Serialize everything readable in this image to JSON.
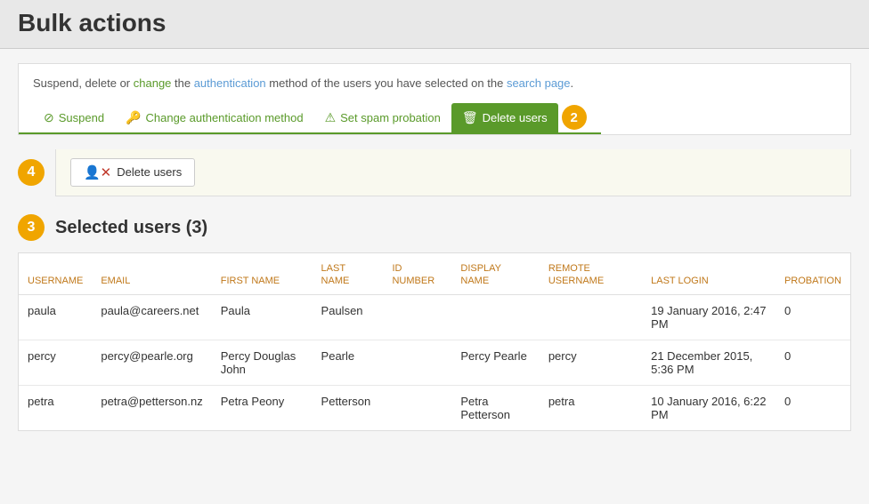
{
  "header": {
    "title": "Bulk actions"
  },
  "info": {
    "text_parts": [
      "Suspend, delete or ",
      "change",
      " the ",
      "authentication",
      " method of the users you have selected on the ",
      "search page",
      "."
    ],
    "description": "Suspend, delete or change the authentication method of the users you have selected on the search page."
  },
  "tabs": [
    {
      "id": "suspend",
      "label": "Suspend",
      "icon": "⊘",
      "active": false
    },
    {
      "id": "change-auth",
      "label": "Change authentication method",
      "icon": "🔑",
      "active": false
    },
    {
      "id": "spam",
      "label": "Set spam probation",
      "icon": "⚠",
      "active": false
    },
    {
      "id": "delete",
      "label": "Delete users",
      "icon": "🗑",
      "active": true
    }
  ],
  "tab_badge": "2",
  "step_badges": {
    "action_step": "4",
    "selected_step": "3"
  },
  "action_button": {
    "label": "Delete users",
    "icon": "user-x"
  },
  "selected_section": {
    "title": "Selected users (3)"
  },
  "table": {
    "columns": [
      {
        "key": "username",
        "label": "USERNAME"
      },
      {
        "key": "email",
        "label": "EMAIL"
      },
      {
        "key": "first_name",
        "label": "FIRST NAME"
      },
      {
        "key": "last_name",
        "label": "LAST NAME"
      },
      {
        "key": "id_number",
        "label": "ID NUMBER"
      },
      {
        "key": "display_name",
        "label": "DISPLAY NAME"
      },
      {
        "key": "remote_username",
        "label": "REMOTE USERNAME"
      },
      {
        "key": "last_login",
        "label": "LAST LOGIN"
      },
      {
        "key": "probation",
        "label": "PROBATION"
      }
    ],
    "rows": [
      {
        "username": "paula",
        "email": "paula@careers.net",
        "first_name": "Paula",
        "last_name": "Paulsen",
        "id_number": "",
        "display_name": "",
        "remote_username": "",
        "last_login": "19 January 2016, 2:47 PM",
        "probation": "0"
      },
      {
        "username": "percy",
        "email": "percy@pearle.org",
        "first_name": "Percy Douglas John",
        "last_name": "Pearle",
        "id_number": "",
        "display_name": "Percy Pearle",
        "remote_username": "percy",
        "last_login": "21 December 2015, 5:36 PM",
        "probation": "0"
      },
      {
        "username": "petra",
        "email": "petra@petterson.nz",
        "first_name": "Petra Peony",
        "last_name": "Petterson",
        "id_number": "",
        "display_name": "Petra Petterson",
        "remote_username": "petra",
        "last_login": "10 January 2016, 6:22 PM",
        "probation": "0"
      }
    ]
  }
}
